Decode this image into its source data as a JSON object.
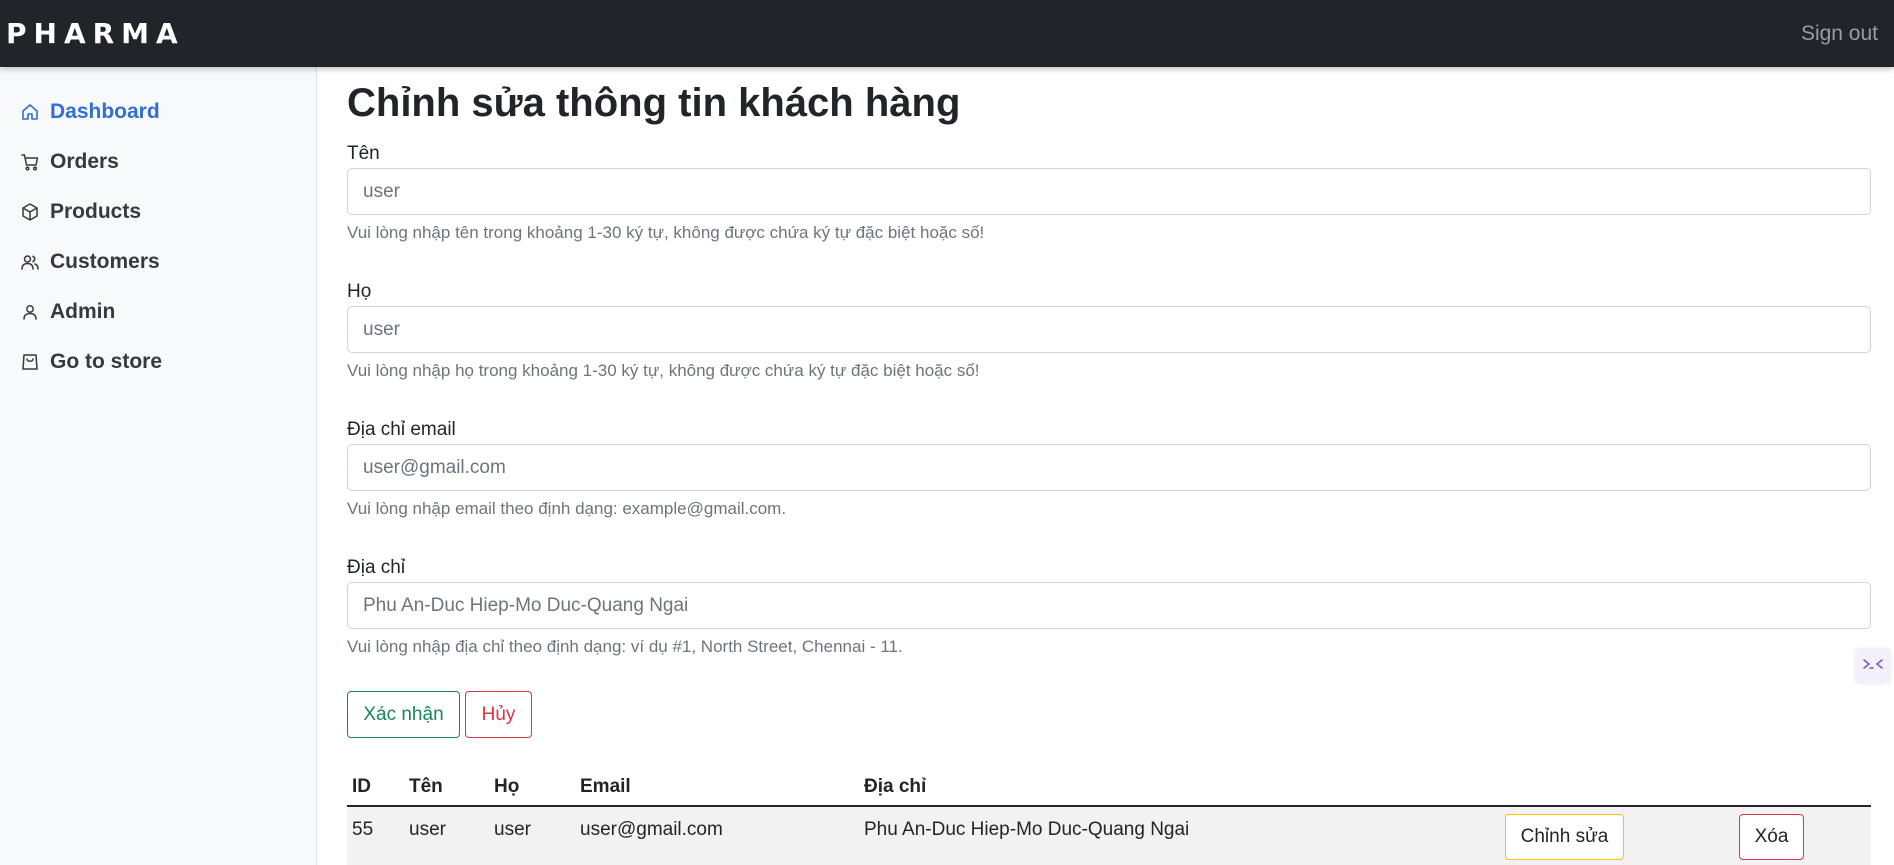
{
  "header": {
    "brand": "PHARMA",
    "signout": "Sign out"
  },
  "sidebar": {
    "items": [
      {
        "label": "Dashboard",
        "icon": "home-icon",
        "active": true
      },
      {
        "label": "Orders",
        "icon": "cart-icon"
      },
      {
        "label": "Products",
        "icon": "box-icon"
      },
      {
        "label": "Customers",
        "icon": "users-icon"
      },
      {
        "label": "Admin",
        "icon": "user-icon"
      },
      {
        "label": "Go to store",
        "icon": "bag-icon"
      }
    ]
  },
  "form": {
    "title": "Chỉnh sửa thông tin khách hàng",
    "first_name": {
      "label": "Tên",
      "value": "user",
      "help": "Vui lòng nhập tên trong khoảng 1-30 ký tự, không được chứa ký tự đặc biệt hoặc số!"
    },
    "last_name": {
      "label": "Họ",
      "value": "user",
      "help": "Vui lòng nhập họ trong khoảng 1-30 ký tự, không được chứa ký tự đặc biệt hoặc số!"
    },
    "email": {
      "label": "Địa chỉ email",
      "value": "user@gmail.com",
      "help": "Vui lòng nhập email theo định dạng: example@gmail.com."
    },
    "address": {
      "label": "Địa chỉ",
      "value": "Phu An-Duc Hiep-Mo Duc-Quang Ngai",
      "help": "Vui lòng nhập địa chỉ theo định dạng: ví dụ #1, North Street, Chennai - 11."
    },
    "confirm_label": "Xác nhận",
    "cancel_label": "Hủy"
  },
  "table": {
    "headers": [
      "ID",
      "Tên",
      "Họ",
      "Email",
      "Địa chỉ"
    ],
    "rows": [
      {
        "id": "55",
        "first": "user",
        "last": "user",
        "email": "user@gmail.com",
        "address": "Phu An-Duc Hiep-Mo Duc-Quang Ngai",
        "edit_label": "Chỉnh sửa",
        "delete_label": "Xóa"
      }
    ]
  },
  "colors": {
    "navbar": "#212529",
    "active_link": "#2f6fd6",
    "success": "#198754",
    "danger": "#dc3545",
    "warning": "#ffc107"
  }
}
